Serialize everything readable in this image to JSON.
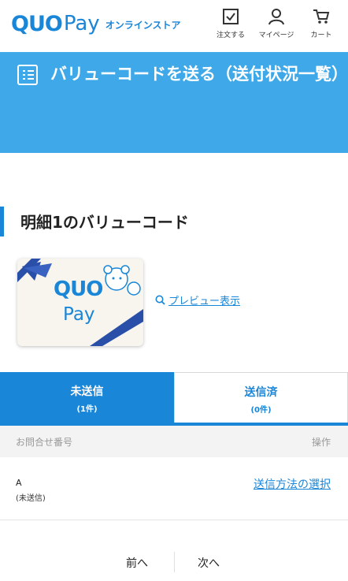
{
  "header": {
    "logo_quo": "QUO",
    "logo_pay": "Pay",
    "logo_sub": "オンラインストア",
    "nav": {
      "order_label": "注文する",
      "mypage_label": "マイページ",
      "cart_label": "カート"
    }
  },
  "banner": {
    "title": "バリューコードを送る（送付状況一覧）",
    "icon": "list-icon"
  },
  "section": {
    "title": "明細1のバリューコード"
  },
  "card": {
    "brand_quo": "QUO",
    "brand_pay": "Pay",
    "preview_label": "プレビュー表示",
    "preview_icon": "search-icon"
  },
  "tabs": [
    {
      "label": "未送信",
      "count": "(1件)",
      "active": true
    },
    {
      "label": "送信済",
      "count": "(0件)",
      "active": false
    }
  ],
  "table": {
    "headers": {
      "inquiry_no": "お問合せ番号",
      "operation": "操作"
    },
    "rows": [
      {
        "id": "A",
        "status": "(未送信)",
        "action": "送信方法の選択"
      }
    ]
  },
  "pager": {
    "prev_label": "前へ",
    "next_label": "次へ"
  },
  "colors": {
    "brand_blue": "#1a86d8",
    "banner_blue": "#3ea8e8",
    "header_gray": "#f3f3f3"
  }
}
